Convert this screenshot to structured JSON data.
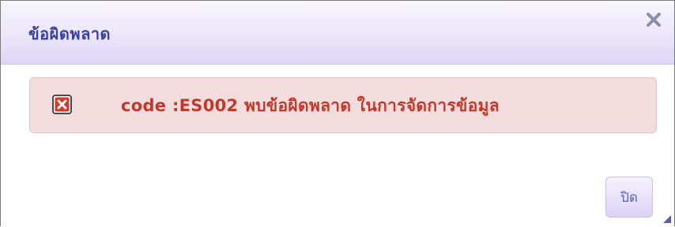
{
  "dialog": {
    "title": "ข้อผิดพลาด",
    "close_icon": "close-icon",
    "close_button_label": "ปิด",
    "resize_icon": "resize-grip-icon"
  },
  "alert": {
    "icon": "error-x-icon",
    "message": "code :ES002 พบข้อผิดพลาด ในการจัดการข้อมูล"
  },
  "colors": {
    "title_text": "#3b3fa0",
    "title_bg": "#ebe6fa",
    "alert_bg": "#f3dcdd",
    "alert_text": "#c0392b",
    "button_text": "#5a5fb8"
  }
}
